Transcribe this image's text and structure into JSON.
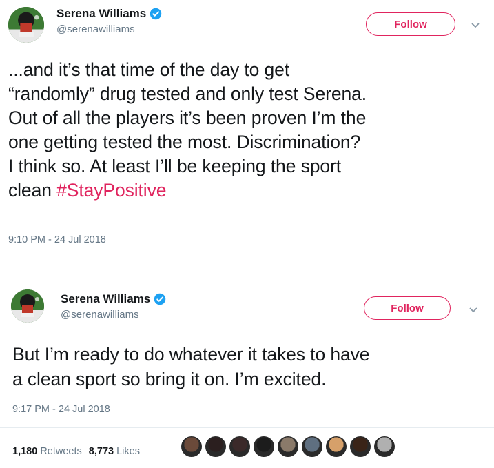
{
  "tweets": [
    {
      "author": {
        "name": "Serena Williams",
        "handle": "@serenawilliams"
      },
      "follow_label": "Follow",
      "text": "...and it’s that time of the day to get\n“randomly” drug tested and only test Serena.\nOut of all the players it’s been proven I’m the\none getting tested the most. Discrimination?\nI think so. At least I’ll be keeping the sport\nclean ",
      "hashtag": "#StayPositive",
      "timestamp": "9:10 PM - 24 Jul 2018"
    },
    {
      "author": {
        "name": "Serena Williams",
        "handle": "@serenawilliams"
      },
      "follow_label": "Follow",
      "text": "But I’m ready to do whatever it takes to have\na clean sport so bring it on. I’m excited.",
      "timestamp": "9:17 PM - 24 Jul 2018",
      "stats": {
        "retweets_count": "1,180",
        "retweets_label": "Retweets",
        "likes_count": "8,773",
        "likes_label": "Likes"
      }
    }
  ],
  "colors": {
    "accent": "#e0245e",
    "verified": "#1da1f2",
    "secondary_text": "#657786"
  },
  "liker_avatar_colors": [
    "#6b4a3a",
    "#2b1f1f",
    "#3b2a2a",
    "#1c1c1c",
    "#8a7a6a",
    "#5f6f80",
    "#d6a06a",
    "#3a2418",
    "#b0b0b0"
  ]
}
